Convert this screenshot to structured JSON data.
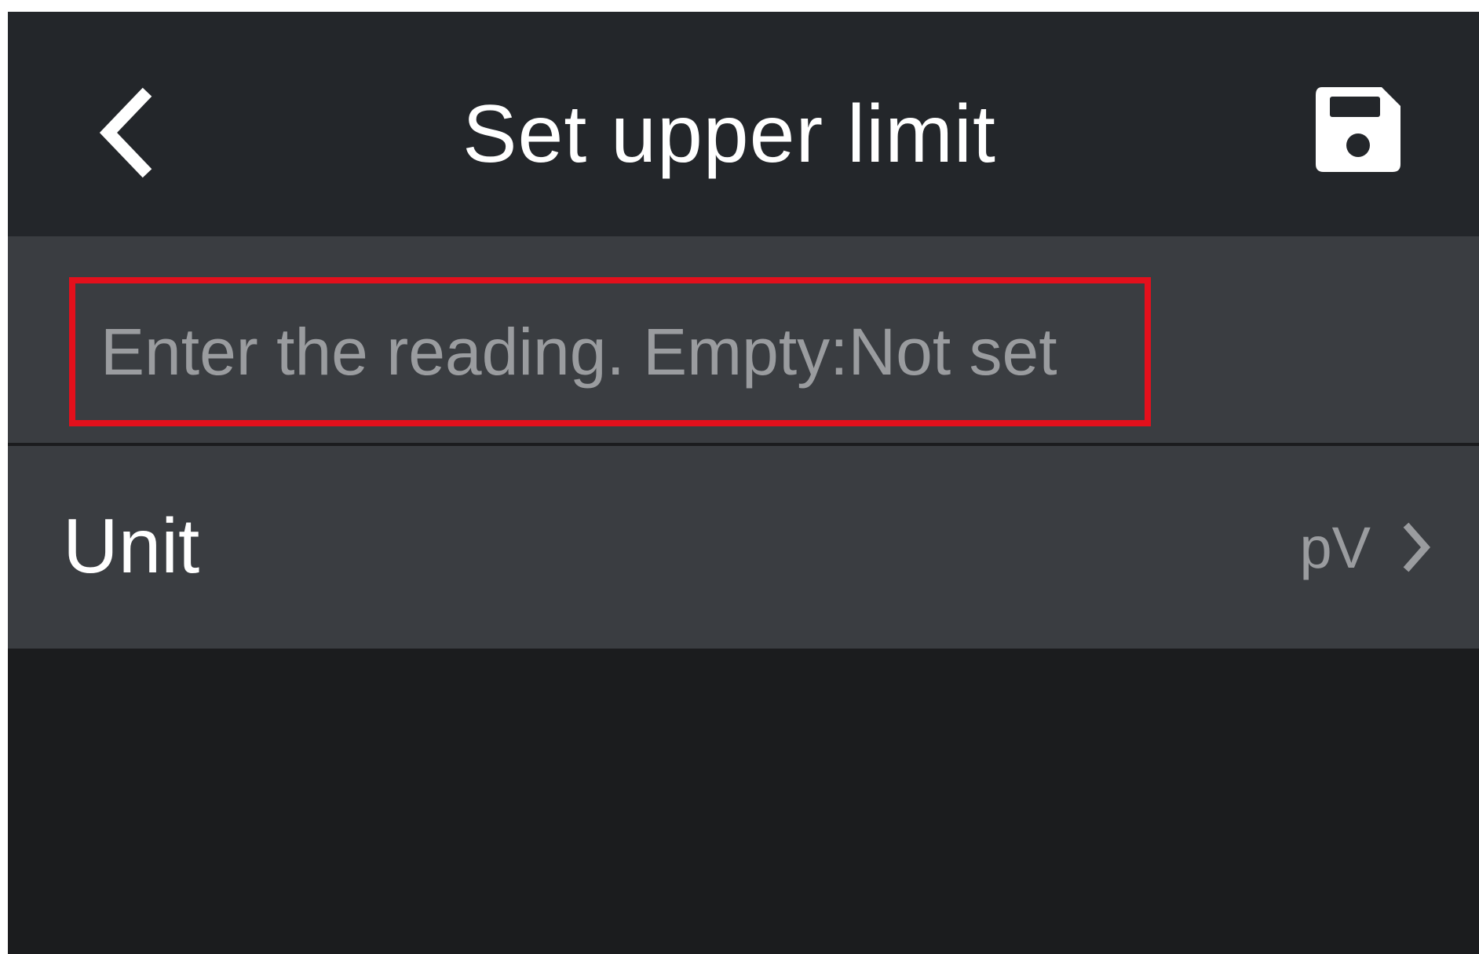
{
  "header": {
    "title": "Set upper limit",
    "back_icon": "chevron-left-icon",
    "save_icon": "floppy-disk-icon"
  },
  "reading_input": {
    "value": "",
    "placeholder": "Enter the reading. Empty:Not set"
  },
  "unit_row": {
    "label": "Unit",
    "value": "pV",
    "icon": "chevron-right-icon"
  },
  "colors": {
    "header_bg": "#23262a",
    "row_bg": "#3a3d41",
    "screen_bg": "#1b1c1e",
    "highlight": "#e3101c",
    "text": "#ffffff",
    "muted_text": "#9a9c9f"
  }
}
